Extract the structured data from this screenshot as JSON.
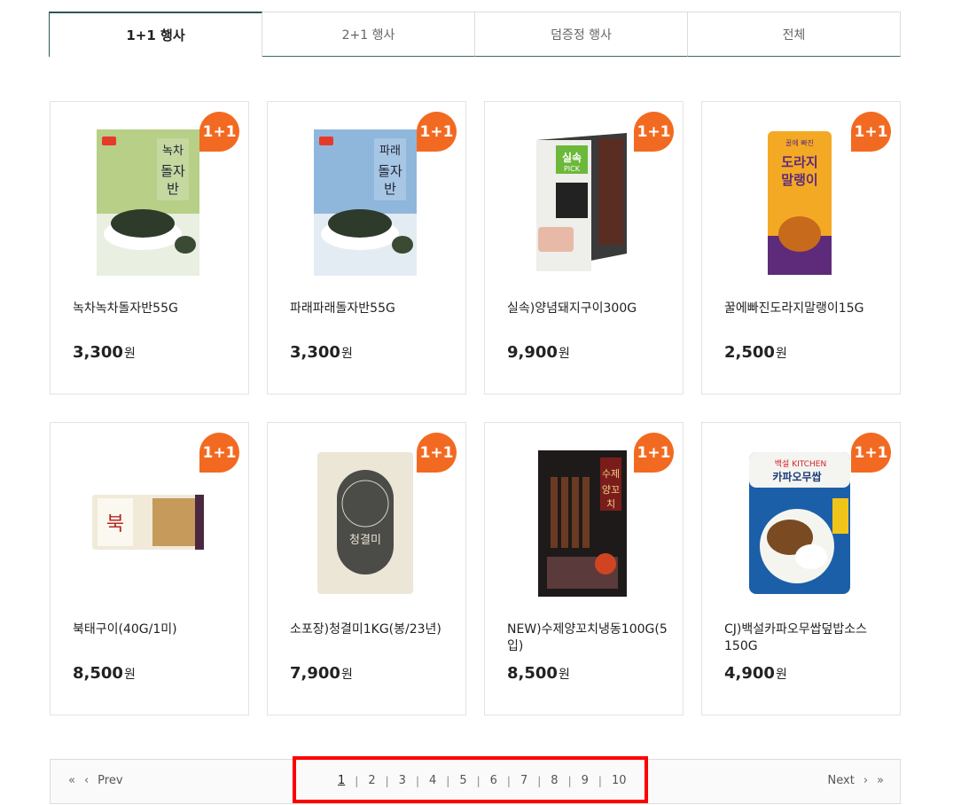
{
  "tabs": [
    {
      "label": "1+1 행사"
    },
    {
      "label": "2+1 행사"
    },
    {
      "label": "덤증정 행사"
    },
    {
      "label": "전체"
    }
  ],
  "products": [
    {
      "badge": "1+1",
      "name": "녹차녹차돌자반55G",
      "price": "3,300",
      "won": "원"
    },
    {
      "badge": "1+1",
      "name": "파래파래돌자반55G",
      "price": "3,300",
      "won": "원"
    },
    {
      "badge": "1+1",
      "name": "실속)양념돼지구이300G",
      "price": "9,900",
      "won": "원"
    },
    {
      "badge": "1+1",
      "name": "꿀에빠진도라지말랭이15G",
      "price": "2,500",
      "won": "원"
    },
    {
      "badge": "1+1",
      "name": "북태구이(40G/1미)",
      "price": "8,500",
      "won": "원"
    },
    {
      "badge": "1+1",
      "name": "소포장)청결미1KG(봉/23년)",
      "price": "7,900",
      "won": "원"
    },
    {
      "badge": "1+1",
      "name": "NEW)수제양꼬치냉동100G(5입)",
      "price": "8,500",
      "won": "원"
    },
    {
      "badge": "1+1",
      "name": "CJ)백설카파오무쌉덮밥소스150G",
      "price": "4,900",
      "won": "원"
    }
  ],
  "pagination": {
    "first_icon": "double-chevron-left-icon",
    "prev_label": "Prev",
    "next_label": "Next",
    "last_icon": "double-chevron-right-icon",
    "pages": [
      "1",
      "2",
      "3",
      "4",
      "5",
      "6",
      "7",
      "8",
      "9",
      "10"
    ],
    "current": "1"
  },
  "colors": {
    "badge": "#f26a21",
    "tab_active_border": "#2d5656",
    "highlight": "#ff0000"
  }
}
